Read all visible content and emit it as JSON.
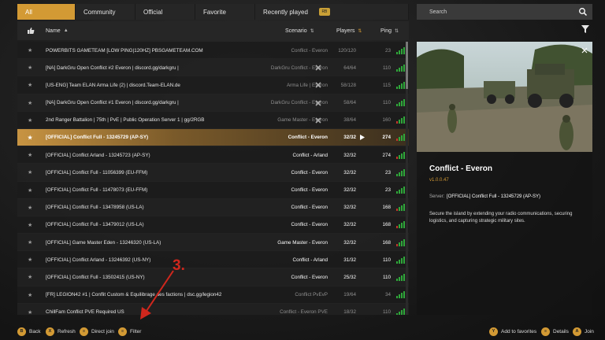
{
  "tabs": [
    {
      "label": "All",
      "active": true
    },
    {
      "label": "Community",
      "active": false
    },
    {
      "label": "Official",
      "active": false
    },
    {
      "label": "Favorite",
      "active": false
    },
    {
      "label": "Recently played",
      "active": false
    }
  ],
  "search": {
    "placeholder": "Search"
  },
  "columns": {
    "name": "Name",
    "scenario": "Scenario",
    "players": "Players",
    "ping": "Ping"
  },
  "servers": [
    {
      "name": "POWERBITS GAMETEAM [LOW PING|120HZ] PBSGAMETEAM.COM",
      "scenario": "Conflict - Everon",
      "players": "120/120",
      "ping": "23",
      "modded": false
    },
    {
      "name": "[NA] DarkGru Open Conflict #2 Everon | discord.gg/darkgru |",
      "scenario": "DarkGru Conflict - Everon",
      "players": "64/64",
      "ping": "110",
      "modded": true
    },
    {
      "name": "[US-ENG] Team ELAN Arma Life (2) | discord.Team-ELAN.de",
      "scenario": "Arma Life | Everon",
      "players": "58/128",
      "ping": "115",
      "modded": true
    },
    {
      "name": "[NA] DarkGru Open Conflict #1 Everon | discord.gg/darkgru |",
      "scenario": "DarkGru Conflict - Everon",
      "players": "58/64",
      "ping": "110",
      "modded": true
    },
    {
      "name": "2nd Ranger Battalion | 75th | PvE | Public Operation Server 1 | gg/2RGB",
      "scenario": "Game Master - Everon",
      "players": "38/64",
      "ping": "160",
      "modded": true
    },
    {
      "name": "[OFFICIAL] Conflict Full - 13245729 (AP-SY)",
      "scenario": "Conflict - Everon",
      "players": "32/32",
      "ping": "274",
      "modded": false,
      "selected": true
    },
    {
      "name": "[OFFICIAL] Conflict Arland - 13245723 (AP-SY)",
      "scenario": "Conflict - Arland",
      "players": "32/32",
      "ping": "274",
      "modded": false
    },
    {
      "name": "[OFFICIAL] Conflict Full - 11056399 (EU-FFM)",
      "scenario": "Conflict - Everon",
      "players": "32/32",
      "ping": "23",
      "modded": false
    },
    {
      "name": "[OFFICIAL] Conflict Full - 11478073 (EU-FFM)",
      "scenario": "Conflict - Everon",
      "players": "32/32",
      "ping": "23",
      "modded": false
    },
    {
      "name": "[OFFICIAL] Conflict Full - 13478958 (US-LA)",
      "scenario": "Conflict - Everon",
      "players": "32/32",
      "ping": "168",
      "modded": false
    },
    {
      "name": "[OFFICIAL] Conflict Full - 13479012 (US-LA)",
      "scenario": "Conflict - Everon",
      "players": "32/32",
      "ping": "168",
      "modded": false
    },
    {
      "name": "[OFFICIAL] Game Master Eden - 13246320 (US-LA)",
      "scenario": "Game Master - Everon",
      "players": "32/32",
      "ping": "168",
      "modded": false
    },
    {
      "name": "[OFFICIAL] Conflict Arland - 13246392 (US-NY)",
      "scenario": "Conflict - Arland",
      "players": "31/32",
      "ping": "110",
      "modded": false
    },
    {
      "name": "[OFFICIAL] Conflict Full - 13502415 (US-NY)",
      "scenario": "Conflict - Everon",
      "players": "25/32",
      "ping": "110",
      "modded": false
    },
    {
      "name": "[FR] LEGION42 #1 | Conflit Custom & Equilibrage des factions | dsc.gg/legion42",
      "scenario": "Conflict PvEvP",
      "players": "19/64",
      "ping": "34",
      "modded": false
    },
    {
      "name": "ChillFam Conflict PVE Required US",
      "scenario": "Conflict - Everon PVE",
      "players": "18/32",
      "ping": "110",
      "modded": false
    }
  ],
  "details": {
    "title": "Conflict - Everon",
    "version": "v1.0.0.47",
    "server_label": "Server:",
    "server_name": "[OFFICIAL] Conflict Full - 13245729 (AP-SY)",
    "description": "Secure the island by extending your radio communications, securing logistics, and capturing strategic military sites."
  },
  "annotation": {
    "label": "3."
  },
  "bottom_actions": [
    {
      "key": "B",
      "label": "Back"
    },
    {
      "key": "X",
      "label": "Refresh"
    },
    {
      "key": "≡",
      "label": "Direct join"
    },
    {
      "key": "≡",
      "label": "Filter"
    },
    {
      "key": "Y",
      "label": "Add to favorites"
    },
    {
      "key": "≡",
      "label": "Details"
    },
    {
      "key": "A",
      "label": "Join"
    }
  ],
  "colors": {
    "accent": "#d39a34",
    "ping_good": "#2fa83a",
    "ping_bad": "#c0392b",
    "annotation": "#d0271d"
  },
  "icons": [
    "thumbs-up-icon",
    "sort-icon",
    "search-icon",
    "filter-icon",
    "star-icon",
    "mod-icon",
    "play-icon",
    "ping-bars-icon"
  ]
}
